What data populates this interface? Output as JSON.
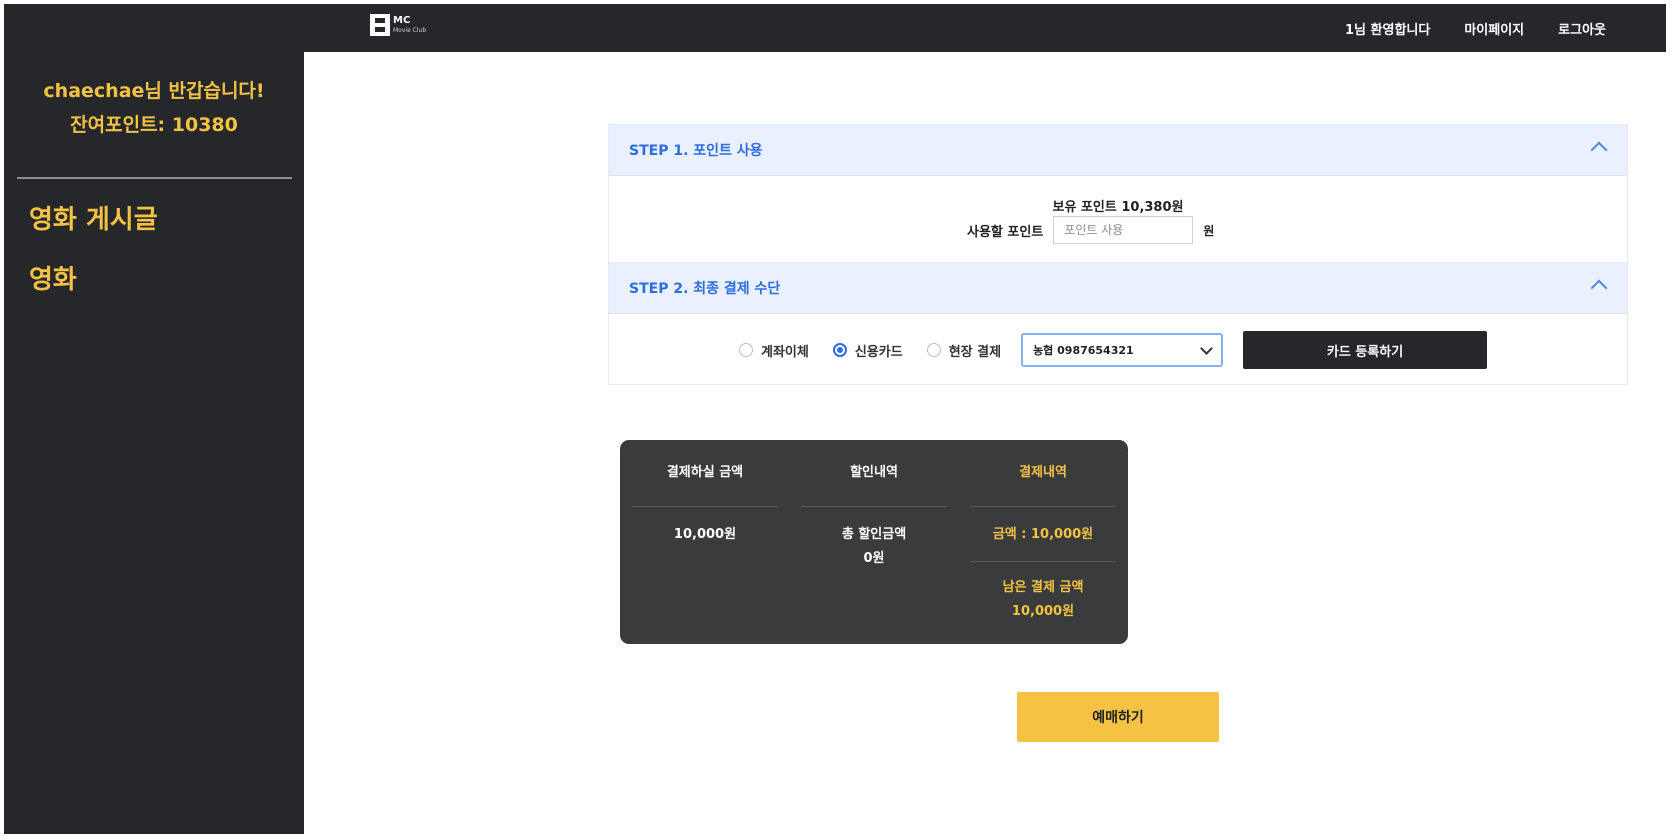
{
  "header": {
    "logo_main": "MC",
    "logo_sub": "Movie Club",
    "nav": [
      "1님 환영합니다",
      "마이페이지",
      "로그아웃"
    ]
  },
  "sidebar": {
    "greeting": "chaechae님 반갑습니다!",
    "points_text": "잔여포인트: 10380",
    "menu": [
      "영화 게시글",
      "영화"
    ]
  },
  "step1": {
    "title": "STEP 1. 포인트 사용",
    "owned_points": "보유 포인트 10,380원",
    "use_label": "사용할 포인트",
    "input_placeholder": "포인트 사용",
    "unit": "원"
  },
  "step2": {
    "title": "STEP 2. 최종 결제 수단",
    "options": [
      {
        "label": "계좌이체",
        "selected": false
      },
      {
        "label": "신용카드",
        "selected": true
      },
      {
        "label": "현장 결제",
        "selected": false
      }
    ],
    "card_selected": "농협 0987654321",
    "register_button": "카드 등록하기"
  },
  "summary": {
    "columns": [
      {
        "title": "결제하실 금액",
        "values": [
          "10,000원"
        ]
      },
      {
        "title": "할인내역",
        "values": [
          "총 할인금액",
          "0원"
        ]
      },
      {
        "title": "결제내역",
        "values": [
          "금액 : 10,000원",
          "남은 결제 금액",
          "10,000원"
        ]
      }
    ]
  },
  "purchase_button": "예매하기",
  "colors": {
    "dark": "#25272b",
    "accent_yellow": "#f5c243",
    "step_blue": "#2f6ce0",
    "step_header_bg": "#e8f1fd",
    "summary_bg": "#3a3b3d"
  }
}
